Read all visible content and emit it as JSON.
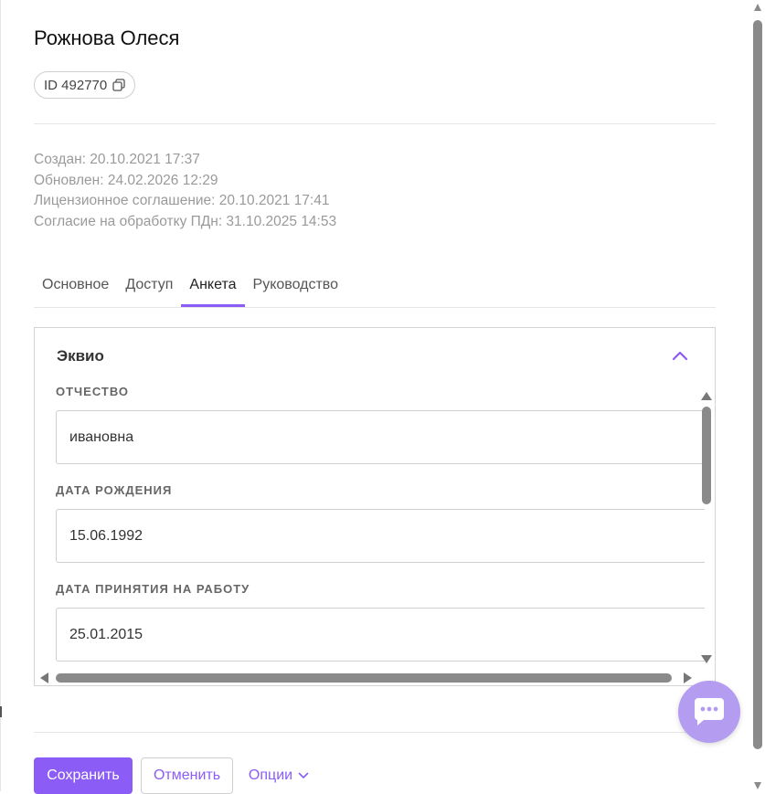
{
  "header": {
    "title": "Рожнова Олеся",
    "id_label": "ID 492770"
  },
  "meta": {
    "created": "Создан: 20.10.2021 17:37",
    "updated": "Обновлен: 24.02.2026 12:29",
    "license": "Лицензионное соглашение: 20.10.2021 17:41",
    "consent": "Согласие на обработку ПДн: 31.10.2025 14:53"
  },
  "tabs": [
    {
      "label": "Основное",
      "active": false
    },
    {
      "label": "Доступ",
      "active": false
    },
    {
      "label": "Анкета",
      "active": true
    },
    {
      "label": "Руководство",
      "active": false
    }
  ],
  "panel": {
    "title": "Эквио",
    "fields": [
      {
        "label": "ОТЧЕСТВО",
        "value": "ивановна"
      },
      {
        "label": "ДАТА РОЖДЕНИЯ",
        "value": "15.06.1992"
      },
      {
        "label": "ДАТА ПРИНЯТИЯ НА РАБОТУ",
        "value": "25.01.2015"
      }
    ]
  },
  "actions": {
    "save": "Сохранить",
    "cancel": "Отменить",
    "options": "Опции"
  },
  "icons": {
    "copy": "copy-icon",
    "collapse": "chevron-up-icon",
    "chat": "chat-icon",
    "options": "chevron-down-icon"
  },
  "colors": {
    "accent": "#8b5cf6",
    "chat_bg": "#b49cf0",
    "muted_text": "#9a9a9a"
  }
}
